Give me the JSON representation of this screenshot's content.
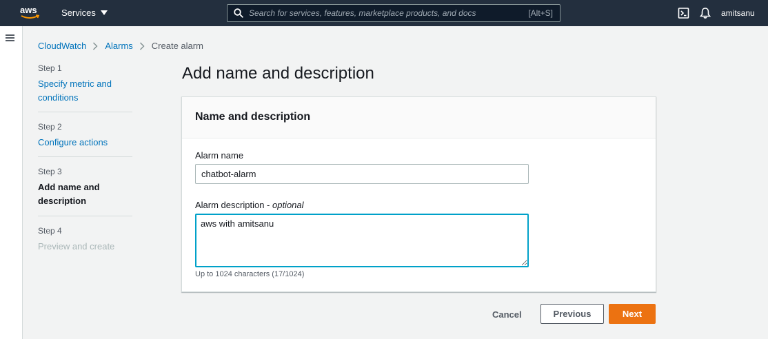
{
  "topnav": {
    "logo_text": "aws",
    "services_label": "Services",
    "search_placeholder": "Search for services, features, marketplace products, and docs",
    "search_shortcut": "[Alt+S]",
    "username": "amitsanu",
    "icons": [
      "cloudshell-icon",
      "bell-icon"
    ]
  },
  "breadcrumb": {
    "items": [
      "CloudWatch",
      "Alarms"
    ],
    "current": "Create alarm"
  },
  "steps": [
    {
      "num": "Step 1",
      "label": "Specify metric and conditions",
      "state": "link"
    },
    {
      "num": "Step 2",
      "label": "Configure actions",
      "state": "link"
    },
    {
      "num": "Step 3",
      "label": "Add name and description",
      "state": "active"
    },
    {
      "num": "Step 4",
      "label": "Preview and create",
      "state": "disabled"
    }
  ],
  "main": {
    "title": "Add name and description",
    "panel_title": "Name and description",
    "alarm_name_label": "Alarm name",
    "alarm_name_value": "chatbot-alarm",
    "description_label": "Alarm description - ",
    "description_optional": "optional",
    "description_value": "aws with amitsanu",
    "description_hint": "Up to 1024 characters (17/1024)"
  },
  "actions": {
    "cancel": "Cancel",
    "previous": "Previous",
    "next": "Next"
  },
  "colors": {
    "nav_bg": "#232f3e",
    "link": "#0073bb",
    "primary": "#ec7211",
    "focus": "#00a1c9"
  }
}
